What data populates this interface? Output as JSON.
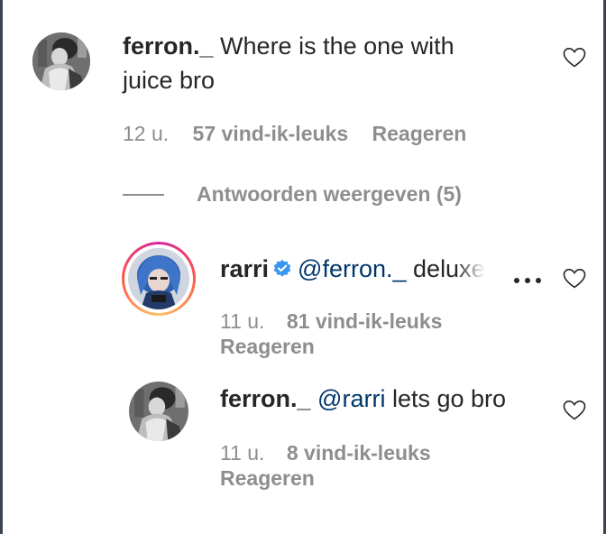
{
  "comment": {
    "username": "ferron._",
    "text_line1": "Where is the one with",
    "text_line2": "juice bro",
    "time": "12 u.",
    "likes": "57 vind-ik-leuks",
    "reply_label": "Reageren"
  },
  "view_replies": {
    "label": "Antwoorden weergeven (5)"
  },
  "replies": [
    {
      "username": "rarri",
      "verified": true,
      "mention": "@ferron._",
      "text": "deluxe",
      "time": "11 u.",
      "likes": "81 vind-ik-leuks",
      "reply_label": "Reageren"
    },
    {
      "username": "ferron._",
      "mention": "@rarri",
      "text": "lets go bro",
      "time": "11 u.",
      "likes": "8 vind-ik-leuks",
      "reply_label": "Reageren"
    }
  ],
  "icons": {
    "like": "heart-outline-icon",
    "more": "more-options-icon",
    "verified": "verified-badge-icon"
  },
  "colors": {
    "text": "#262626",
    "secondary": "#8e8e8e",
    "mention": "#00376b",
    "verified": "#3897f0"
  }
}
